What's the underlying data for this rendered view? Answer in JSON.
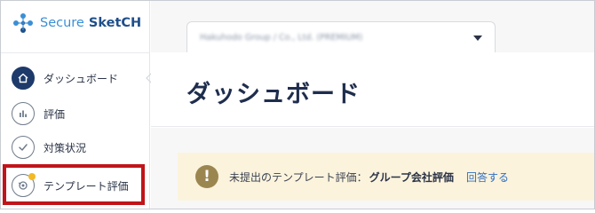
{
  "logo": {
    "secure": "Secure",
    "sketch": "SketCH"
  },
  "org_tab": {
    "label": "Hakuhodo Group / Co., Ltd. (PREMIUM)"
  },
  "sidebar": {
    "items": [
      {
        "label": "ダッシュボード",
        "icon": "home-icon",
        "active": true
      },
      {
        "label": "評価",
        "icon": "bar-chart-icon",
        "active": false
      },
      {
        "label": "対策状況",
        "icon": "check-icon",
        "active": false
      },
      {
        "label": "テンプレート評価",
        "icon": "template-eval-icon",
        "active": false,
        "notification": true
      }
    ]
  },
  "page": {
    "title": "ダッシュボード"
  },
  "alert": {
    "icon": "exclamation-icon",
    "glyph": "!",
    "text": "未提出のテンプレート評価：",
    "strong": "グループ会社評価",
    "link": "回答する"
  },
  "colors": {
    "accent": "#1d3a6b",
    "highlight": "#c0151a",
    "notification": "#f2b926",
    "alert_bg": "#fbf3dc",
    "link": "#2f6fc1"
  }
}
